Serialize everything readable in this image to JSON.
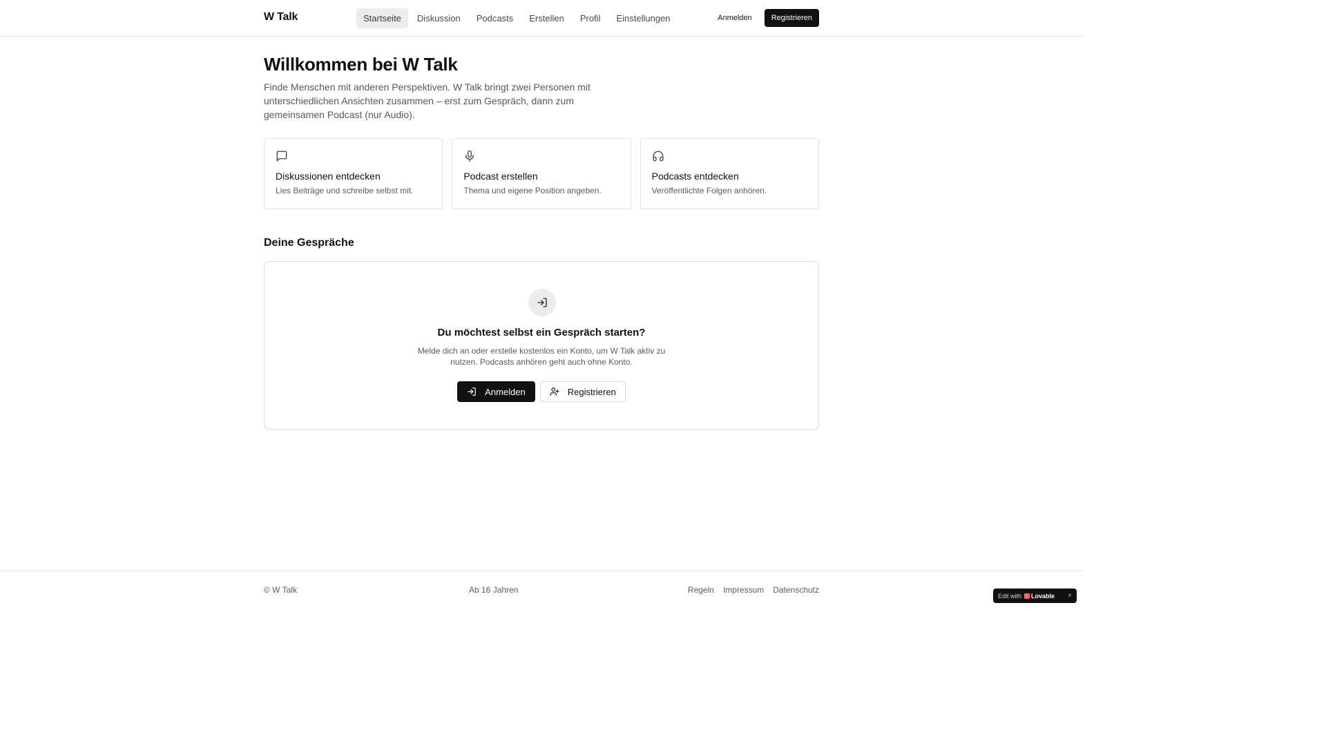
{
  "header": {
    "brand": "W Talk",
    "nav": [
      {
        "label": "Startseite"
      },
      {
        "label": "Diskussion"
      },
      {
        "label": "Podcasts"
      },
      {
        "label": "Erstellen"
      },
      {
        "label": "Profil"
      },
      {
        "label": "Einstellungen"
      }
    ],
    "login_label": "Anmelden",
    "register_label": "Registrieren"
  },
  "hero": {
    "title": "Willkommen bei W Talk",
    "subtitle": "Finde Menschen mit anderen Perspektiven. W Talk bringt zwei Personen mit unterschiedlichen Ansichten zusammen – erst zum Gespräch, dann zum gemeinsamen Podcast (nur Audio)."
  },
  "cards": [
    {
      "icon": "message-square-icon",
      "title": "Diskussionen entdecken",
      "desc": "Lies Beiträge und schreibe selbst mit."
    },
    {
      "icon": "microphone-icon",
      "title": "Podcast erstellen",
      "desc": "Thema und eigene Position angeben."
    },
    {
      "icon": "headphones-icon",
      "title": "Podcasts entdecken",
      "desc": "Veröffentlichte Folgen anhören."
    }
  ],
  "conversations": {
    "title": "Deine Gespräche",
    "empty_icon": "log-in-icon",
    "empty_title": "Du möchtest selbst ein Gespräch starten?",
    "empty_desc": "Melde dich an oder erstelle kostenlos ein Konto, um W Talk aktiv zu nutzen. Podcasts anhören geht auch ohne Konto.",
    "login_label": "Anmelden",
    "register_label": "Registrieren"
  },
  "footer": {
    "copyright": "© W Talk",
    "age": "Ab 16 Jahren",
    "links": [
      {
        "label": "Regeln"
      },
      {
        "label": "Impressum"
      },
      {
        "label": "Datenschutz"
      }
    ]
  },
  "badge": {
    "text": "Edit with",
    "brand": "Lovable",
    "close": "×"
  },
  "colors": {
    "primary": "#111111",
    "muted_text": "#5c5c5c",
    "border": "#e2e2e2",
    "active_nav_bg": "#ececec"
  }
}
